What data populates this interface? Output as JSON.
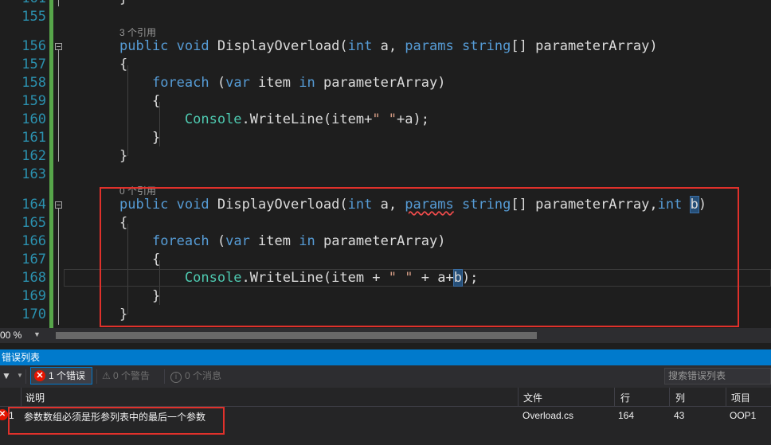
{
  "editor": {
    "line_numbers": [
      "161",
      "155",
      "156",
      "157",
      "158",
      "159",
      "160",
      "161",
      "162",
      "163",
      "164",
      "165",
      "166",
      "167",
      "168",
      "169",
      "170"
    ],
    "ref_labels": [
      "3 个引用",
      "0 个引用"
    ]
  },
  "zoom": {
    "value": "00 %"
  },
  "error_panel": {
    "title": "错误列表",
    "errors_button": "1 个错误",
    "warnings_button": "0 个警告",
    "messages_button": "0 个消息",
    "search_placeholder": "搜索错误列表",
    "columns": [
      "说明",
      "文件",
      "行",
      "列",
      "项目"
    ],
    "rows": [
      {
        "index": "1",
        "description": "参数数组必须是形参列表中的最后一个参数",
        "file": "Overload.cs",
        "line": "164",
        "column": "43",
        "project": "OOP1"
      }
    ]
  },
  "colors": {
    "accent": "#007acc",
    "error": "#e51400",
    "annotation": "#e0312b",
    "change_bar": "#57a64a"
  }
}
